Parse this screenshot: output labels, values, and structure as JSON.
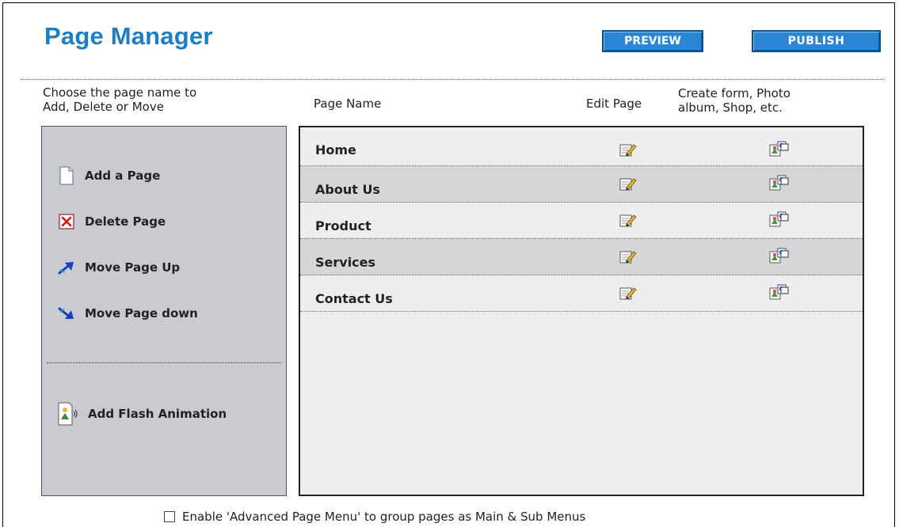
{
  "header": {
    "title": "Page Manager",
    "preview_label": "PREVIEW",
    "publish_label": "PUBLISH"
  },
  "instructions": {
    "line1": "Choose the page name to",
    "line2": "Add, Delete or Move"
  },
  "columns": {
    "page_name": "Page Name",
    "edit_page": "Edit Page",
    "create_line1": "Create form, Photo",
    "create_line2": "album, Shop, etc."
  },
  "actions": {
    "add_page": "Add a Page",
    "delete_page": "Delete Page",
    "move_up": "Move Page Up",
    "move_down": "Move Page down",
    "add_flash": "Add Flash Animation"
  },
  "pages": [
    {
      "name": "Home"
    },
    {
      "name": "About Us"
    },
    {
      "name": "Product"
    },
    {
      "name": "Services"
    },
    {
      "name": "Contact Us"
    }
  ],
  "footer": {
    "advanced_menu_label": "Enable 'Advanced Page Menu' to group pages as Main & Sub Menus",
    "advanced_menu_checked": false
  },
  "colors": {
    "title": "#1a7ec8",
    "button_bg": "#2a86d4",
    "left_panel_bg": "#cacbd0",
    "row_alt_bg": "#d6d6d9"
  }
}
